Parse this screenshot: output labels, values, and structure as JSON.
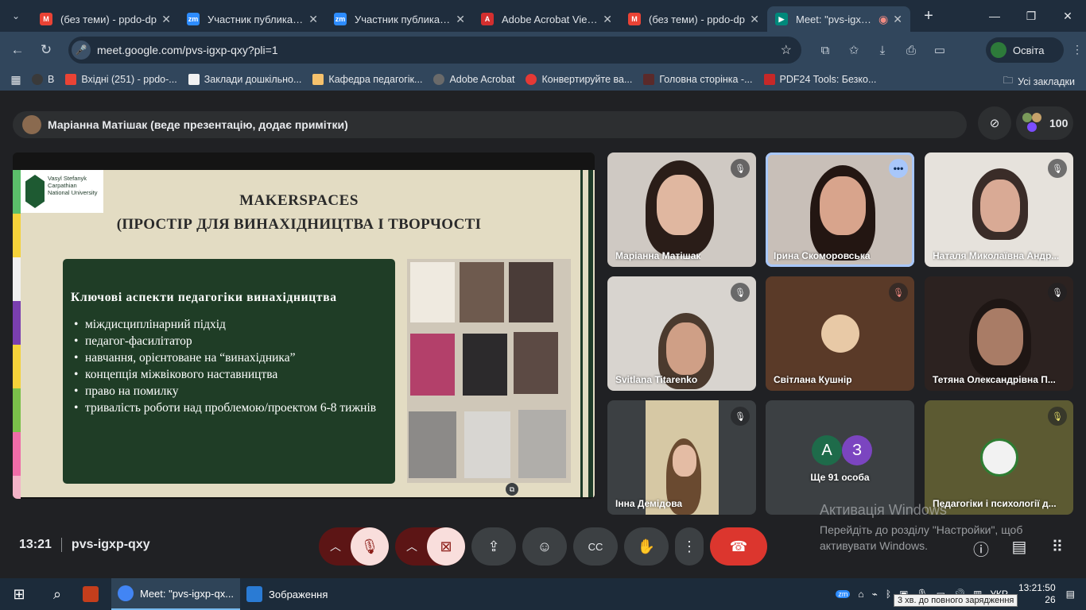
{
  "browser": {
    "tabs": [
      {
        "title": "(без теми) - ppdo-dp",
        "icon": "gmail-icon",
        "color": "#ea4335"
      },
      {
        "title": "Участник публикаци",
        "icon": "zoom-icon",
        "color": "#2d8cff"
      },
      {
        "title": "Участник публикаци",
        "icon": "zoom-icon",
        "color": "#2d8cff"
      },
      {
        "title": "Adobe Acrobat Viewe",
        "icon": "acrobat-icon",
        "color": "#d32f2f"
      },
      {
        "title": "(без теми) - ppdo-dp",
        "icon": "gmail-icon",
        "color": "#ea4335"
      },
      {
        "title": "Meet: \"pvs-igxp-q",
        "icon": "meet-icon",
        "color": "#00897b"
      }
    ],
    "url": "meet.google.com/pvs-igxp-qxy?pli=1",
    "profile_name": "Освіта",
    "bookmarks": [
      {
        "label": "В",
        "color": "#3a3a3a"
      },
      {
        "label": "Вхідні (251) - ppdo-...",
        "color": "#ea4335"
      },
      {
        "label": "Заклади дошкільно...",
        "color": "#f1f1f1"
      },
      {
        "label": "Кафедра педагогік...",
        "color": "#f5c16c"
      },
      {
        "label": "Adobe Acrobat",
        "color": "#444"
      },
      {
        "label": "Конвертируйте ва...",
        "color": "#e53935"
      },
      {
        "label": "Головна сторінка -...",
        "color": "#5a2a2a"
      },
      {
        "label": "PDF24 Tools: Безко...",
        "color": "#c62828"
      }
    ],
    "all_bookmarks": "Усі закладки"
  },
  "meet": {
    "presenter_text": "Маріанна Матішак (веде презентацію, додає примітки)",
    "participants_count": "100",
    "slide": {
      "logo_text": "Vasyl Stefanyk Carpathian National University",
      "title_line1": "MAKERSPACES",
      "title_line2": "(ПРОСТІР ДЛЯ ВИНАХІДНИЦТВА І ТВОРЧОСТІ",
      "box_heading": "Ключові аспекти педагогіки винахідництва",
      "bullets": [
        "міждисциплінарний підхід",
        "педагог-фасилітатор",
        "навчання, орієнтоване на “винахідника”",
        "концепція міжвікового наставництва",
        "право на помилку",
        "тривалість роботи над проблемою/проектом 6-8 тижнів"
      ]
    },
    "tiles": [
      {
        "name": "Маріанна Матішак"
      },
      {
        "name": "Ірина Скоморовська"
      },
      {
        "name": "Наталя Миколаївна Андр..."
      },
      {
        "name": "Svitlana Titarenko"
      },
      {
        "name": "Світлана Кушнір"
      },
      {
        "name": "Тетяна Олександрівна П..."
      },
      {
        "name": "Інна Демідова"
      },
      {
        "name": "Ще 91 особа",
        "initial_a": "А",
        "initial_b": "З"
      },
      {
        "name": "Педагогіки і психології д..."
      }
    ],
    "watermark_line1": "Активація Windows",
    "watermark_line2": "Перейдіть до розділу \"Настройки\", щоб",
    "watermark_line3": "активувати Windows.",
    "time": "13:21",
    "meeting_code": "pvs-igxp-qxy"
  },
  "taskbar": {
    "apps": [
      {
        "label": "Meet: \"pvs-igxp-qx..."
      },
      {
        "label": "Зображення"
      }
    ],
    "lang": "УКР",
    "clock_time": "13:21:50",
    "clock_date_frag": "26",
    "tooltip": "3 хв. до повного зарядження"
  }
}
